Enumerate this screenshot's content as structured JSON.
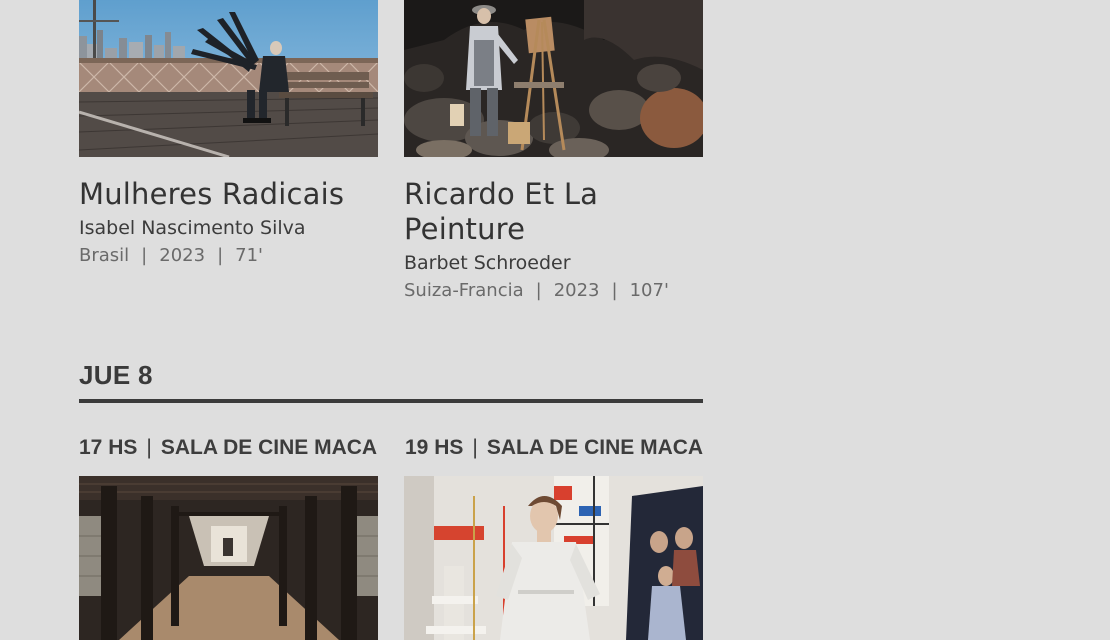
{
  "films_top": [
    {
      "title": "Mulheres Radicais",
      "director": "Isabel Nascimento Silva",
      "country": "Brasil",
      "year": "2023",
      "duration": "71'"
    },
    {
      "title": "Ricardo Et La Peinture",
      "director": "Barbet Schroeder",
      "country": "Suiza-Francia",
      "year": "2023",
      "duration": "107'"
    }
  ],
  "day": {
    "label": "JUE 8"
  },
  "slots": [
    {
      "time": "17 HS",
      "separator": "|",
      "venue": "SALA DE CINE MACA"
    },
    {
      "time": "19 HS",
      "separator": "|",
      "venue": "SALA DE CINE MACA"
    }
  ],
  "meta_separator": "|",
  "colors": {
    "background": "#dedede",
    "text_primary": "#333333",
    "text_secondary": "#6a6a6a",
    "rule": "#3b3b3b"
  }
}
